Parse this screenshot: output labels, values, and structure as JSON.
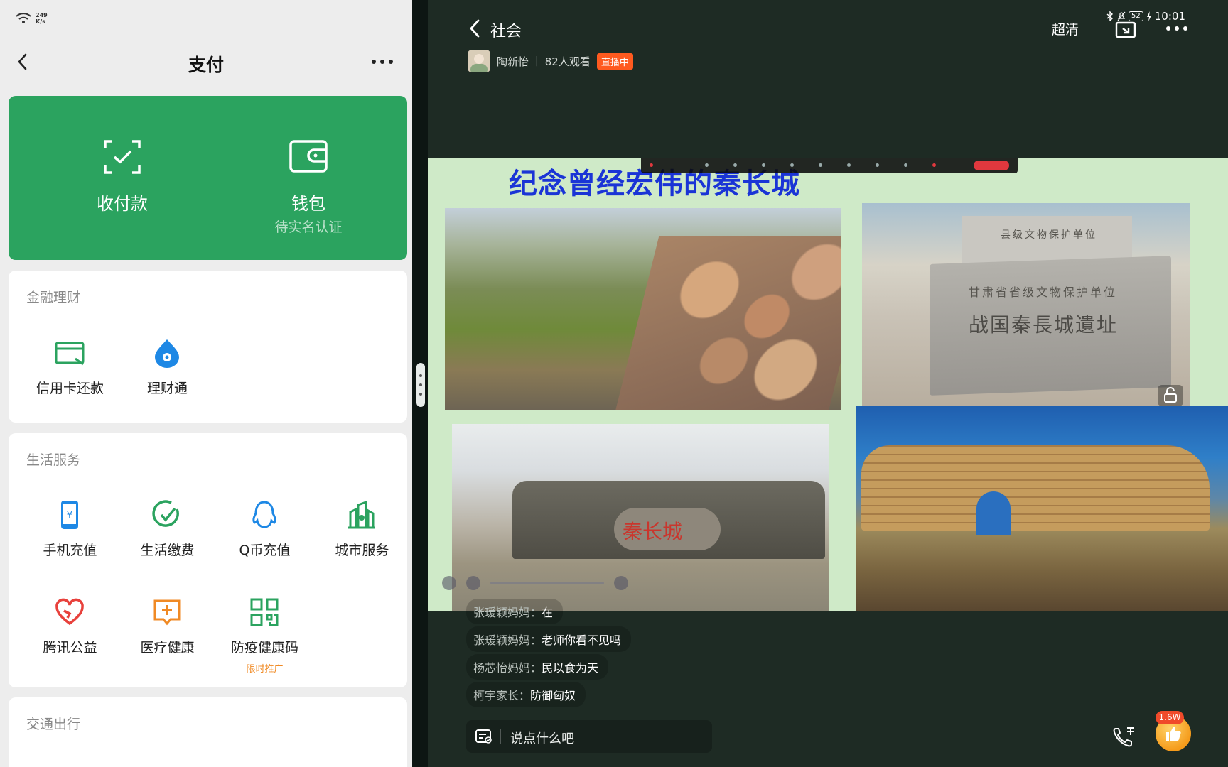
{
  "status_left": {
    "net_speed_value": "249",
    "net_speed_unit": "K/s"
  },
  "pay": {
    "title": "支付",
    "green_card": {
      "collect": {
        "label": "收付款",
        "icon": "scan-check-icon"
      },
      "wallet": {
        "label": "钱包",
        "sub": "待实名认证",
        "icon": "wallet-icon"
      }
    },
    "sections": [
      {
        "title": "金融理财",
        "items": [
          {
            "label": "信用卡还款",
            "icon": "credit-card-icon",
            "color": "#2ba35f"
          },
          {
            "label": "理财通",
            "icon": "wealth-drop-icon",
            "color": "#1e88e5"
          }
        ]
      },
      {
        "title": "生活服务",
        "items": [
          {
            "label": "手机充值",
            "icon": "phone-yen-icon",
            "color": "#1e88e5"
          },
          {
            "label": "生活缴费",
            "icon": "check-circle-icon",
            "color": "#2ba35f"
          },
          {
            "label": "Q币充值",
            "icon": "penguin-icon",
            "color": "#1e88e5"
          },
          {
            "label": "城市服务",
            "icon": "city-buildings-icon",
            "color": "#2ba35f"
          },
          {
            "label": "腾讯公益",
            "icon": "heart-icon",
            "color": "#e8413c"
          },
          {
            "label": "医疗健康",
            "icon": "medical-box-icon",
            "color": "#f08a24"
          },
          {
            "label": "防疫健康码",
            "icon": "qr-code-icon",
            "color": "#2ba35f",
            "promo": "限时推广"
          }
        ]
      },
      {
        "title": "交通出行",
        "items": []
      }
    ]
  },
  "live": {
    "channel": "社会",
    "quality": "超清",
    "status": {
      "battery": "52",
      "time": "10:01"
    },
    "host": {
      "name": "陶新怡",
      "viewers": "82人观看",
      "badge": "直播中"
    },
    "slide_title": "纪念曾经宏伟的秦长城",
    "photo_texts": {
      "plaque_top": "县级文物保护单位",
      "plaque_mid": "甘肃省省级文物保护单位",
      "plaque_main": "战国秦長城遺址",
      "red_carving": "秦长城"
    },
    "comments": [
      {
        "user": "张瑗颖妈妈",
        "msg": "在"
      },
      {
        "user": "张瑗颖妈妈",
        "msg": "老师你看不见吗"
      },
      {
        "user": "杨芯怡妈妈",
        "msg": "民以食为天"
      },
      {
        "user": "柯宇家长",
        "msg": "防御匈奴"
      }
    ],
    "input_placeholder": "说点什么吧",
    "like_count": "1.6W",
    "accent": "#ff5a1f"
  }
}
